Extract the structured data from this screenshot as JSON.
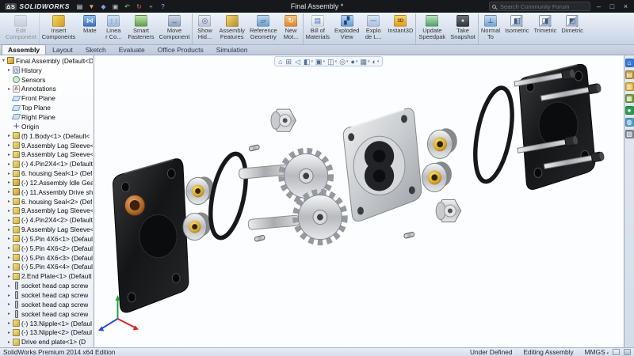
{
  "colors": {
    "titlebar_bg": "#17181c",
    "viewport_bg": "#fcfdfe",
    "accent_blue": "#3f6fb4"
  },
  "titlebar": {
    "app_name": "SOLIDWORKS",
    "logo_mark": "ΔS",
    "title": "Final Assembly *",
    "search_placeholder": "Search Community Forum",
    "menu_icons": [
      {
        "name": "new-document-icon",
        "glyph": "▤"
      },
      {
        "name": "open-icon",
        "glyph": "▼"
      },
      {
        "name": "save-icon",
        "glyph": "◆"
      },
      {
        "name": "print-icon",
        "glyph": "▣"
      },
      {
        "name": "undo-icon",
        "glyph": "↶"
      },
      {
        "name": "rebuild-icon",
        "glyph": "↻"
      },
      {
        "name": "options-icon",
        "glyph": "+"
      },
      {
        "name": "help-icon",
        "glyph": "?"
      }
    ],
    "window": {
      "minimize": "–",
      "maximize": "□",
      "close": "×"
    }
  },
  "toolbar": {
    "buttons": [
      {
        "icon": "edit-component",
        "label1": "Edit",
        "label2": "Component",
        "disabled": "true"
      },
      {
        "icon": "insert-components",
        "label1": "Insert",
        "label2": "Components"
      },
      {
        "icon": "mate",
        "label1": "Mate",
        "label2": ""
      },
      {
        "icon": "linear-pattern",
        "label1": "Linea",
        "label2": "r Co..."
      },
      {
        "icon": "smart-fasteners",
        "label1": "Smart",
        "label2": "Fasteners"
      },
      {
        "icon": "move-component",
        "label1": "Move",
        "label2": "Component"
      },
      {
        "icon": "show-hidden",
        "label1": "Show",
        "label2": "Hid..."
      },
      {
        "icon": "assembly-features",
        "label1": "Assembly",
        "label2": "Features"
      },
      {
        "icon": "reference-geometry",
        "label1": "Reference",
        "label2": "Geometry"
      },
      {
        "icon": "new-motion",
        "label1": "New",
        "label2": "Mot..."
      },
      {
        "icon": "bill-of-materials",
        "label1": "Bill of",
        "label2": "Materials"
      },
      {
        "icon": "exploded-view",
        "label1": "Exploded",
        "label2": "View"
      },
      {
        "icon": "explode-line",
        "label1": "Explo",
        "label2": "de L..."
      },
      {
        "icon": "instant3d",
        "label1": "Instant3D",
        "label2": ""
      },
      {
        "icon": "update-speedpak",
        "label1": "Update",
        "label2": "Speedpak"
      },
      {
        "icon": "take-snapshot",
        "label1": "Take",
        "label2": "Snapshot"
      },
      {
        "icon": "normal-to",
        "label1": "Normal",
        "label2": "To"
      },
      {
        "icon": "isometric",
        "label1": "Isometric",
        "label2": ""
      },
      {
        "icon": "trimetric",
        "label1": "Trimetric",
        "label2": ""
      },
      {
        "icon": "dimetric",
        "label1": "Dimetric",
        "label2": ""
      }
    ]
  },
  "tabs": {
    "items": [
      {
        "label": "Assembly",
        "active": "true"
      },
      {
        "label": "Layout",
        "active": ""
      },
      {
        "label": "Sketch",
        "active": ""
      },
      {
        "label": "Evaluate",
        "active": ""
      },
      {
        "label": "Office Products",
        "active": ""
      },
      {
        "label": "Simulation",
        "active": ""
      }
    ]
  },
  "tree": {
    "items": [
      {
        "icon": "assembly",
        "expand": "▾",
        "indent": "0",
        "label": "Final Assembly (Default<D"
      },
      {
        "icon": "history",
        "expand": "▸",
        "indent": "1",
        "label": "History"
      },
      {
        "icon": "sensors",
        "expand": "",
        "indent": "1",
        "label": "Sensors"
      },
      {
        "icon": "annotations",
        "expand": "▸",
        "indent": "1",
        "label": "Annotations"
      },
      {
        "icon": "plane",
        "expand": "",
        "indent": "1",
        "label": "Front Plane"
      },
      {
        "icon": "plane",
        "expand": "",
        "indent": "1",
        "label": "Top Plane"
      },
      {
        "icon": "plane",
        "expand": "",
        "indent": "1",
        "label": "Right Plane"
      },
      {
        "icon": "origin",
        "expand": "",
        "indent": "1",
        "label": "Origin"
      },
      {
        "icon": "part",
        "expand": "▸",
        "indent": "1",
        "label": "(f) 1.Body<1> (Default<"
      },
      {
        "icon": "part",
        "expand": "▸",
        "indent": "1",
        "label": "9.Assembly Lag Sleeve<"
      },
      {
        "icon": "part",
        "expand": "▸",
        "indent": "1",
        "label": "9.Assembly Lag Sleeve<"
      },
      {
        "icon": "part",
        "expand": "▸",
        "indent": "1",
        "label": "(-) 4.Pin2X4<1> (Default"
      },
      {
        "icon": "seal",
        "expand": "▸",
        "indent": "1",
        "label": "6. housing Seal<1> (Def"
      },
      {
        "icon": "subasm",
        "expand": "▸",
        "indent": "1",
        "label": "(-) 12.Assembly Idle Gea"
      },
      {
        "icon": "subasm",
        "expand": "▸",
        "indent": "1",
        "label": "(-) 11.Assembly Drive sh"
      },
      {
        "icon": "seal",
        "expand": "▸",
        "indent": "1",
        "label": "6. housing Seal<2> (Def"
      },
      {
        "icon": "part",
        "expand": "▸",
        "indent": "1",
        "label": "9.Assembly Lag Sleeve<"
      },
      {
        "icon": "part",
        "expand": "▸",
        "indent": "1",
        "label": "(-) 4.Pin2X4<2> (Default"
      },
      {
        "icon": "part",
        "expand": "▸",
        "indent": "1",
        "label": "9.Assembly Lag Sleeve<"
      },
      {
        "icon": "part",
        "expand": "▸",
        "indent": "1",
        "label": "(-) 5.Pin 4X6<1> (Defaul"
      },
      {
        "icon": "part",
        "expand": "▸",
        "indent": "1",
        "label": "(-) 5.Pin 4X6<2> (Defaul"
      },
      {
        "icon": "part",
        "expand": "▸",
        "indent": "1",
        "label": "(-) 5.Pin 4X6<3> (Defaul"
      },
      {
        "icon": "part",
        "expand": "▸",
        "indent": "1",
        "label": "(-) 5.Pin 4X6<4> (Defaul"
      },
      {
        "icon": "part",
        "expand": "▸",
        "indent": "1",
        "label": "2.End Plate<1> (Default"
      },
      {
        "icon": "screw",
        "expand": "▸",
        "indent": "1",
        "label": "socket head cap screw"
      },
      {
        "icon": "screw",
        "expand": "▸",
        "indent": "1",
        "label": "socket head cap screw"
      },
      {
        "icon": "screw",
        "expand": "▸",
        "indent": "1",
        "label": "socket head cap screw"
      },
      {
        "icon": "screw",
        "expand": "▸",
        "indent": "1",
        "label": "socket head cap screw"
      },
      {
        "icon": "fitting",
        "expand": "▸",
        "indent": "1",
        "label": "(-) 13.Nipple<1> (Defaul"
      },
      {
        "icon": "fitting",
        "expand": "▸",
        "indent": "1",
        "label": "(-) 13.Nipple<2> (Defaul"
      },
      {
        "icon": "part",
        "expand": "▸",
        "indent": "1",
        "label": "Drive end plate<1> (D"
      }
    ]
  },
  "headsup": {
    "icons": [
      {
        "name": "zoom-fit-icon",
        "glyph": "⌂",
        "caret": ""
      },
      {
        "name": "zoom-area-icon",
        "glyph": "⊞",
        "caret": ""
      },
      {
        "name": "previous-view-icon",
        "glyph": "◁",
        "caret": ""
      },
      {
        "name": "section-view-icon",
        "glyph": "◧",
        "caret": "▾"
      },
      {
        "name": "view-orientation-icon",
        "glyph": "▣",
        "caret": "▾"
      },
      {
        "name": "display-style-icon",
        "glyph": "◫",
        "caret": "▾"
      },
      {
        "name": "hide-show-icon",
        "glyph": "◎",
        "caret": "▾"
      },
      {
        "name": "edit-appearance-icon",
        "glyph": "●",
        "caret": "▾"
      },
      {
        "name": "apply-scene-icon",
        "glyph": "▦",
        "caret": "▾"
      },
      {
        "name": "view-settings-icon",
        "glyph": "◐",
        "caret": "▾"
      }
    ]
  },
  "taskpane": {
    "icons": [
      {
        "name": "resources-icon",
        "glyph": "⌂"
      },
      {
        "name": "design-library-icon",
        "glyph": "▤"
      },
      {
        "name": "file-explorer-icon",
        "glyph": "▥"
      },
      {
        "name": "view-palette-icon",
        "glyph": "▦"
      },
      {
        "name": "appearances-icon",
        "glyph": "●"
      },
      {
        "name": "scene-icon",
        "glyph": "◍"
      },
      {
        "name": "custom-properties-icon",
        "glyph": "▧"
      }
    ]
  },
  "statusbar": {
    "edition": "SolidWorks Premium 2014 x64 Edition",
    "constraint_status": "Under Defined",
    "mode": "Editing Assembly",
    "units": "MMGS"
  }
}
